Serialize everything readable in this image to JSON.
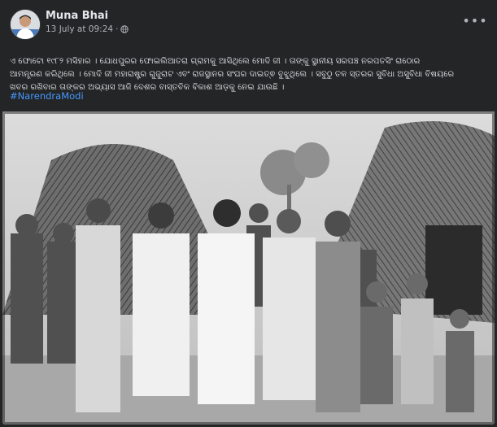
{
  "post": {
    "author": "Muna Bhai",
    "date": "13 July at 09:24",
    "separator": "·",
    "privacy_icon": "globe-icon",
    "more_icon": "ellipsis-icon",
    "text_line1": "ଏ ଫୋଟୋ ୧୯୮୨ ମସିହାର । ଯୋଧପୁରର ଫୋଇଲିଆତରା ଗ୍ରାମକୁ ଆସିଥିଲେ ମୋଦି ଜୀ । ତାଙ୍କୁ ସ୍ଥାନୀୟ ସରପଞ୍ଚ ନରପତସିଂ ରାଠୋର",
    "text_line2": "ଆମନ୍ତ୍ରଣ କରିଥିଲେ । ମୋଦି ଜୀ ମହାରାଷ୍ଟ୍ର ଗୁଜୁରାଟ ଏବଂ ରାଜସ୍ଥାନର ସଂଘର ଦାଇତ୍ଵ ବୁଝୁଥିଲେ । ସବୁଠୁ ତଳ ସ୍ତରର ସୁବିଧା ଅସୁବିଧା ବିଷୟରେ",
    "text_line3": "ଖବର ରଖିବାର ତାଙ୍କର ଅଭ୍ୟାସ ଆଜି ଦେଶର ବାସ୍ତବିକ ବିକାଶ ଆଡ଼କୁ ନେଇ ଯାଉଛି ।",
    "hashtag": "#NarendraModi"
  },
  "colors": {
    "background": "#242526",
    "primary_text": "#e4e6eb",
    "secondary_text": "#b0b3b8",
    "link": "#4599ff"
  }
}
